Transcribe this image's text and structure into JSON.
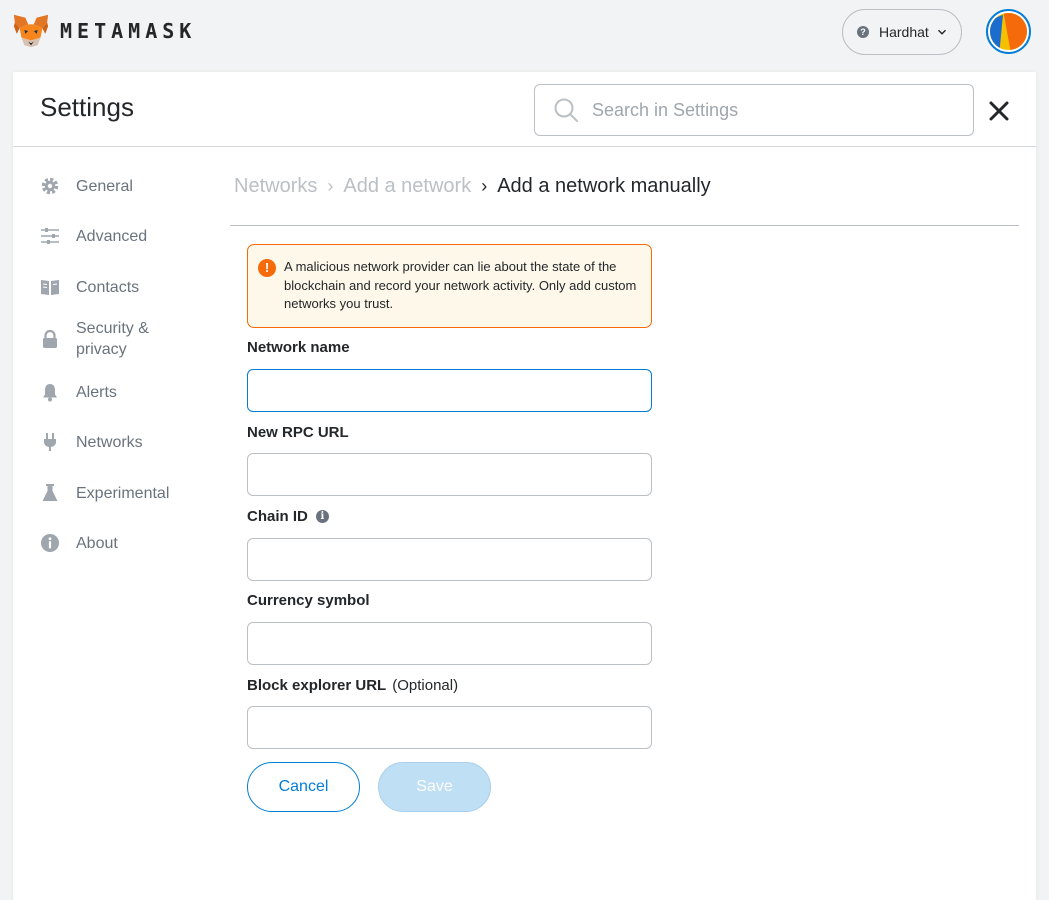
{
  "app": {
    "wordmark": "METAMASK"
  },
  "network": {
    "name": "Hardhat",
    "badge": "?"
  },
  "settings": {
    "title": "Settings",
    "search_placeholder": "Search in Settings"
  },
  "sidebar": {
    "items": [
      {
        "label": "General",
        "icon": "gear-icon"
      },
      {
        "label": "Advanced",
        "icon": "sliders-icon"
      },
      {
        "label": "Contacts",
        "icon": "book-icon"
      },
      {
        "label": "Security & privacy",
        "icon": "lock-icon"
      },
      {
        "label": "Alerts",
        "icon": "bell-icon"
      },
      {
        "label": "Networks",
        "icon": "plug-icon"
      },
      {
        "label": "Experimental",
        "icon": "flask-icon"
      },
      {
        "label": "About",
        "icon": "info-icon"
      }
    ]
  },
  "breadcrumb": {
    "items": [
      "Networks",
      "Add a network",
      "Add a network manually"
    ]
  },
  "warning": {
    "icon": "!",
    "text": "A malicious network provider can lie about the state of the blockchain and record your network activity. Only add custom networks you trust."
  },
  "form": {
    "network_name": {
      "label": "Network name",
      "value": ""
    },
    "rpc_url": {
      "label": "New RPC URL",
      "value": ""
    },
    "chain_id": {
      "label": "Chain ID",
      "info": "i",
      "value": ""
    },
    "currency_symbol": {
      "label": "Currency symbol",
      "value": ""
    },
    "block_explorer": {
      "label": "Block explorer URL",
      "optional": "(Optional)",
      "value": ""
    }
  },
  "buttons": {
    "cancel": "Cancel",
    "save": "Save"
  },
  "colors": {
    "primary": "#037dd6",
    "warning_border": "#f66a0a",
    "warning_bg": "#fef8ea",
    "muted_text": "#6a737d",
    "disabled_button": "#bfdff5"
  }
}
